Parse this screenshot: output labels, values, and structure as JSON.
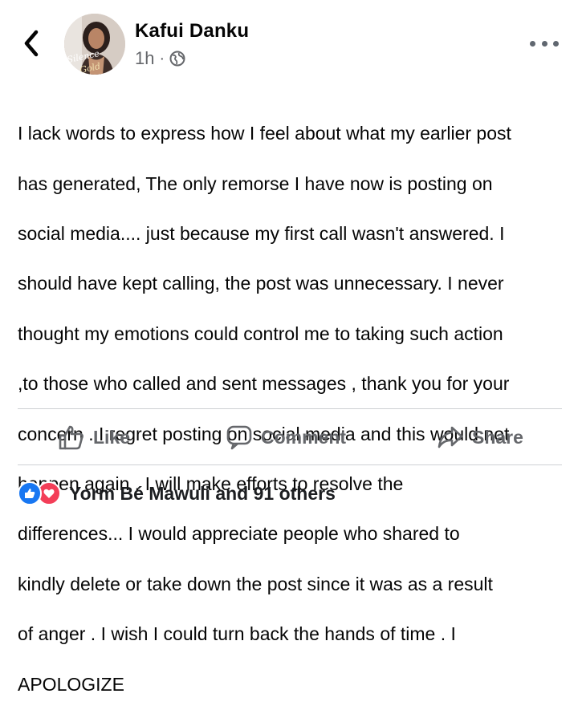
{
  "header": {
    "author_name": "Kafui Danku",
    "timestamp": "1h",
    "separator": "·",
    "avatar_caption": "Silence Gold",
    "back_icon": "chevron-left-icon",
    "privacy_icon": "globe-icon",
    "more_icon": "more-horizontal-icon"
  },
  "post": {
    "lines": [
      "I lack words to express how I feel about what my earlier post",
      "has generated,  The only remorse I have now is posting on",
      "social media.... just because my first call wasn't answered. I",
      "should have kept calling, the post was unnecessary.  I never",
      "thought my emotions could control me to taking such action",
      ",to those who called and sent messages , thank you for your",
      "concern . I regret posting on social media and this would not",
      "happen again . I will make efforts to resolve the",
      "differences... I would appreciate people who shared to",
      "kindly delete or take down the post since it was as a result",
      "of anger . I wish I could turn back the hands of time .  I",
      "APOLOGIZE"
    ]
  },
  "actions": {
    "like_label": "Like",
    "comment_label": "Comment",
    "share_label": "Share"
  },
  "reactions": {
    "summary": "Yorm Bé Mawuli and 91 others",
    "icons": [
      "like-reaction-icon",
      "love-reaction-icon"
    ]
  },
  "colors": {
    "text": "#050505",
    "muted": "#65676b",
    "like_blue": "#1877f2",
    "love_red": "#f33e58",
    "divider": "#ced0d4"
  }
}
